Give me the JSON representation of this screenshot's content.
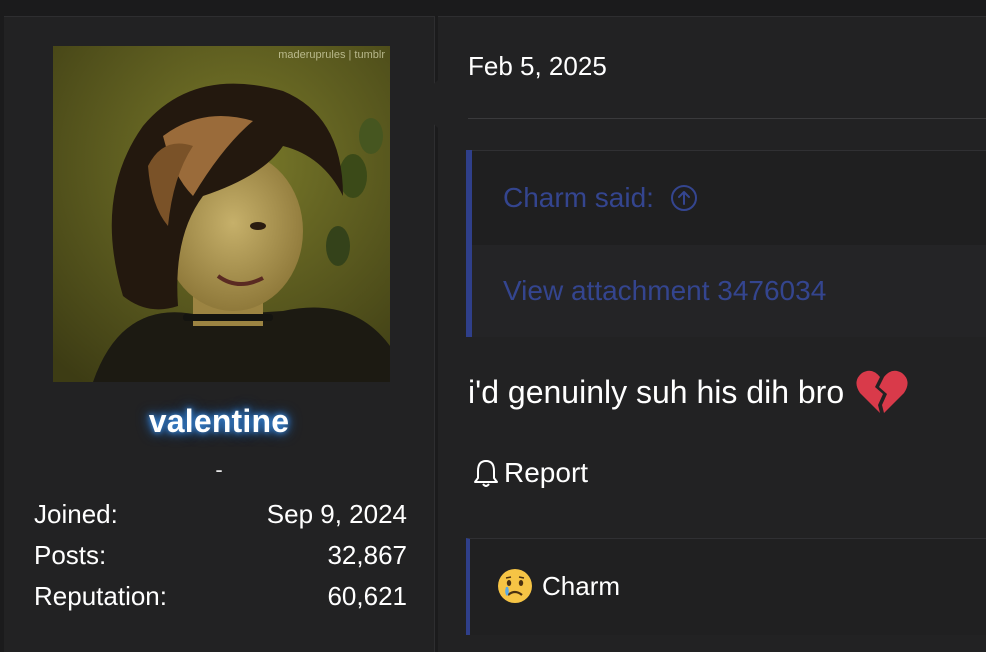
{
  "user": {
    "username": "valentine",
    "title": "-",
    "avatar_watermark": "maderuprules | tumblr",
    "stats": [
      {
        "label": "Joined:",
        "value": "Sep 9, 2024"
      },
      {
        "label": "Posts:",
        "value": "32,867"
      },
      {
        "label": "Reputation:",
        "value": "60,621"
      }
    ]
  },
  "post": {
    "date": "Feb 5, 2025",
    "quote": {
      "author_label": "Charm said:",
      "icon": "arrow-up-circle-icon",
      "body": "View attachment 3476034"
    },
    "message": "i'd genuinly suh his dih bro",
    "message_emoji": "broken-heart-icon",
    "report_label": "Report",
    "report_icon": "bell-icon",
    "reactions": [
      {
        "icon": "crying-face-icon",
        "user": "Charm"
      }
    ]
  },
  "colors": {
    "background": "#1b1b1c",
    "panel": "#222223",
    "quote_accent": "#2f3f8a",
    "quote_text": "#34458f",
    "username_glow": "#3e8ddb",
    "broken_heart": "#d93a4a"
  }
}
